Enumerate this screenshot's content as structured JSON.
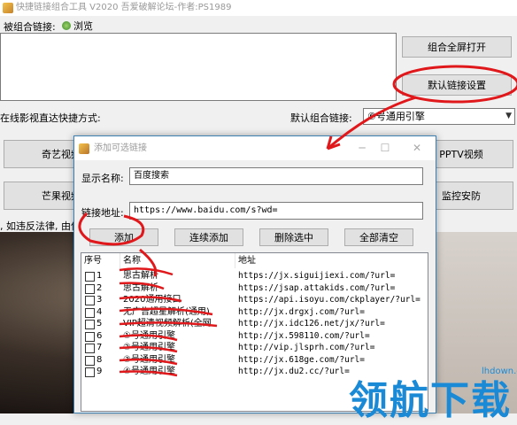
{
  "main_window": {
    "title": "快捷链接组合工具 V2020  吾爱破解论坛-作者:PS1989",
    "combined_links_label": "被组合链接:",
    "browse_label": "浏览",
    "open_fullscreen_button": "组合全屏打开",
    "default_link_settings_button": "默认链接设置",
    "shortcut_label": "在线影视直达快捷方式:",
    "default_combo_label": "默认组合链接:",
    "default_combo_value": "⑥号通用引擎",
    "video_buttons_left": [
      "奇艺视频",
      "芒果视频"
    ],
    "video_buttons_right": [
      "PPTV视频",
      "监控安防"
    ],
    "notice_text": ", 如违反法律, 由使"
  },
  "dialog": {
    "title": "添加可选链接",
    "display_name_label": "显示名称:",
    "display_name_value": "百度搜索",
    "link_address_label": "链接地址:",
    "link_address_value": "https://www.baidu.com/s?wd=",
    "buttons": [
      "添加",
      "连续添加",
      "删除选中",
      "全部清空"
    ],
    "columns": [
      "序号",
      "名称",
      "地址"
    ],
    "rows": [
      {
        "idx": "1",
        "name": "思古解析",
        "addr": "https://jx.siguijiexi.com/?url="
      },
      {
        "idx": "2",
        "name": "思古解析",
        "addr": "https://jsap.attakids.com/?url="
      },
      {
        "idx": "3",
        "name": "2020通用接口",
        "addr": "https://api.isoyu.com/ckplayer/?url="
      },
      {
        "idx": "4",
        "name": "无广告超星解析(通用)",
        "addr": "http://jx.drgxj.com/?url="
      },
      {
        "idx": "5",
        "name": "VIP超清视频解析(全网",
        "addr": "http://jx.idc126.net/jx/?url="
      },
      {
        "idx": "6",
        "name": "①号通用引擎",
        "addr": "http://jx.598110.com/?url="
      },
      {
        "idx": "7",
        "name": "②号通用引擎",
        "addr": "http://vip.jlsprh.com/?url="
      },
      {
        "idx": "8",
        "name": "③号通用引擎",
        "addr": "http://jx.618ge.com/?url="
      },
      {
        "idx": "9",
        "name": "④号通用引擎",
        "addr": "http://jx.du2.cc/?url="
      }
    ]
  },
  "watermark": {
    "text": "领航下载",
    "domain": "lhdown.com"
  },
  "colors": {
    "annotation": "#e0181b",
    "dialog_border": "#3c7fb1",
    "watermark": "#1b8ad6"
  }
}
